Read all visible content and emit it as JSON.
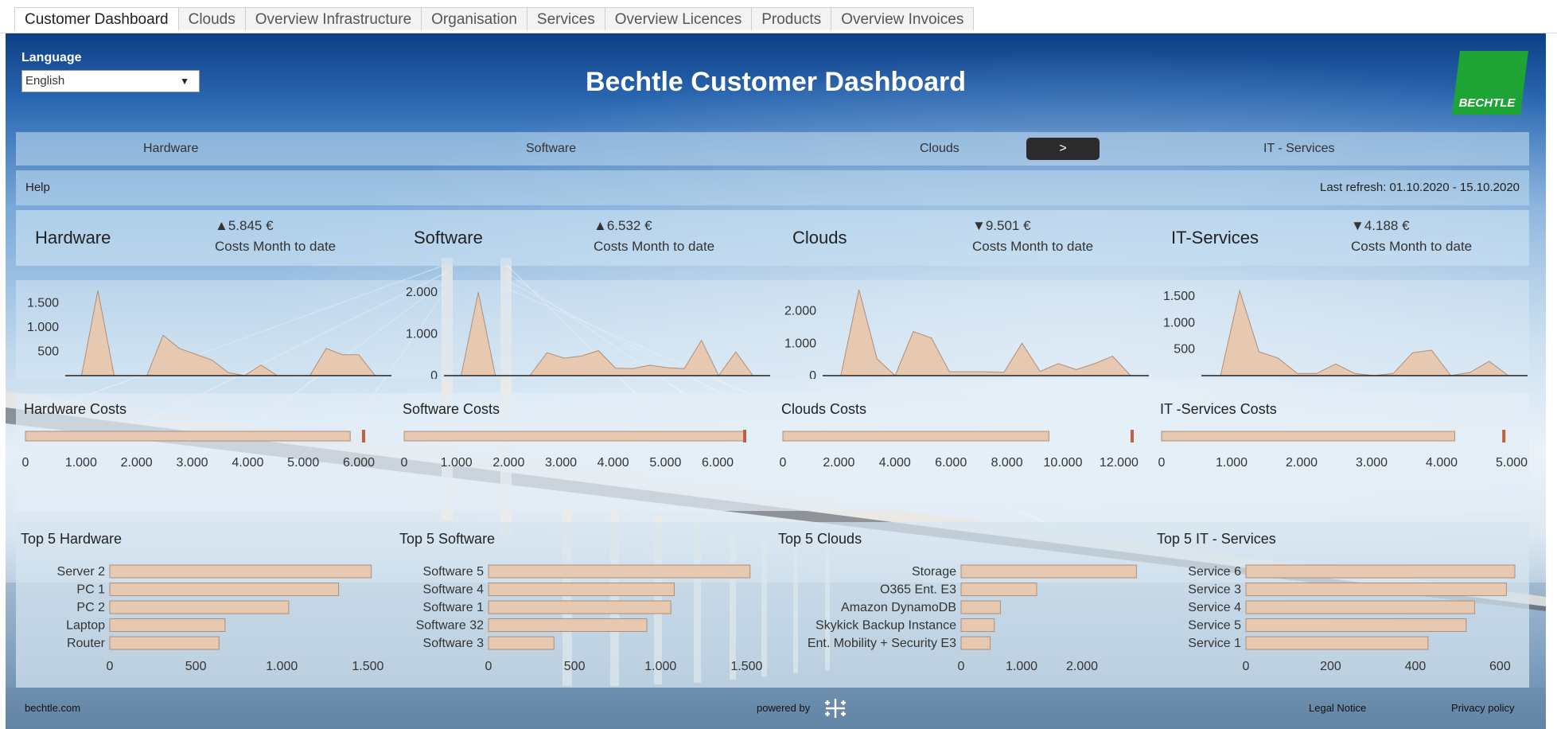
{
  "tabs": [
    "Customer Dashboard",
    "Clouds",
    "Overview Infrastructure",
    "Organisation",
    "Services",
    "Overview Licences",
    "Products",
    "Overview Invoices"
  ],
  "header": {
    "title": "Bechtle Customer Dashboard",
    "language_label": "Language",
    "language_value": "English",
    "logo_text": "BECHTLE"
  },
  "nav": {
    "hardware": "Hardware",
    "software": "Software",
    "clouds": "Clouds",
    "arrow": ">",
    "it_services": "IT - Services"
  },
  "help": "Help",
  "last_refresh": "Last refresh: 01.10.2020 - 15.10.2020",
  "kpis": [
    {
      "name": "Hardware",
      "value": "▲5.845 €",
      "label": "Costs Month to date"
    },
    {
      "name": "Software",
      "value": "▲6.532 €",
      "label": "Costs Month to date"
    },
    {
      "name": "Clouds",
      "value": "▼9.501 €",
      "label": "Costs Month to date"
    },
    {
      "name": "IT-Services",
      "value": "▼4.188 €",
      "label": "Costs Month to date"
    }
  ],
  "colors": {
    "bar": "#e7c8b0",
    "bar_edge": "#b08e77",
    "marker": "#c0603e",
    "logo": "#1ea335",
    "arrow_bg": "#2b2b2b"
  },
  "footer": {
    "left": "bechtle.com",
    "powered": "powered by",
    "legal": "Legal Notice",
    "privacy": "Privacy policy"
  },
  "chart_data": [
    {
      "type": "area",
      "group": "hardware",
      "y_ticks": [
        "500",
        "1.000",
        "1.500"
      ],
      "ylim": [
        0,
        1800
      ],
      "values": [
        0,
        0,
        1750,
        0,
        0,
        0,
        830,
        560,
        440,
        320,
        60,
        0,
        220,
        0,
        0,
        0,
        560,
        430,
        430,
        0,
        0
      ]
    },
    {
      "type": "area",
      "group": "software",
      "y_ticks": [
        "0",
        "1.000",
        "2.000"
      ],
      "ylim": [
        0,
        2100
      ],
      "values": [
        0,
        0,
        2000,
        0,
        0,
        0,
        550,
        420,
        470,
        600,
        180,
        170,
        250,
        190,
        170,
        850,
        0,
        570,
        0,
        0
      ]
    },
    {
      "type": "area",
      "group": "clouds",
      "y_ticks": [
        "0",
        "1.000",
        "2.000"
      ],
      "ylim": [
        0,
        2700
      ],
      "values": [
        0,
        0,
        2650,
        520,
        0,
        1360,
        1160,
        120,
        120,
        120,
        100,
        1000,
        130,
        370,
        190,
        370,
        600,
        0,
        0
      ]
    },
    {
      "type": "area",
      "group": "it_services",
      "y_ticks": [
        "500",
        "1.000",
        "1.500"
      ],
      "ylim": [
        0,
        1650
      ],
      "values": [
        0,
        0,
        1600,
        450,
        330,
        40,
        40,
        220,
        40,
        0,
        40,
        430,
        480,
        0,
        60,
        270,
        0,
        0
      ]
    },
    {
      "type": "bar",
      "title": "Hardware Costs",
      "ticks": [
        "0",
        "1.000",
        "2.000",
        "3.000",
        "4.000",
        "5.000",
        "6.000"
      ],
      "xlim": [
        0,
        6300
      ],
      "value": 5845,
      "reference": 6100
    },
    {
      "type": "bar",
      "title": "Software Costs",
      "ticks": [
        "0",
        "1.000",
        "2.000",
        "3.000",
        "4.000",
        "5.000",
        "6.000"
      ],
      "xlim": [
        0,
        6700
      ],
      "value": 6532,
      "reference": 6532
    },
    {
      "type": "bar",
      "title": "Clouds Costs",
      "ticks": [
        "0",
        "2.000",
        "4.000",
        "6.000",
        "8.000",
        "10.000",
        "12.000"
      ],
      "xlim": [
        0,
        12500
      ],
      "value": 9501,
      "reference": 13000
    },
    {
      "type": "bar",
      "title": "IT -Services Costs",
      "ticks": [
        "0",
        "1.000",
        "2.000",
        "3.000",
        "4.000",
        "5.000"
      ],
      "xlim": [
        0,
        5000
      ],
      "value": 4188,
      "reference": 4900
    },
    {
      "type": "bar",
      "title": "Top 5 Hardware",
      "categories": [
        "Server 2",
        "PC 1",
        "PC 2",
        "Laptop",
        "Router"
      ],
      "values": [
        1520,
        1330,
        1040,
        670,
        635
      ],
      "ticks": [
        "0",
        "500",
        "1.000",
        "1.500"
      ],
      "tick_values": [
        0,
        500,
        1000,
        1500
      ],
      "xlim": [
        0,
        1600
      ]
    },
    {
      "type": "bar",
      "title": "Top 5 Software",
      "categories": [
        "Software 5",
        "Software 4",
        "Software 1",
        "Software 32",
        "Software 3"
      ],
      "values": [
        1520,
        1080,
        1060,
        920,
        380
      ],
      "ticks": [
        "0",
        "500",
        "1.000",
        "1.500"
      ],
      "tick_values": [
        0,
        500,
        1000,
        1500
      ],
      "xlim": [
        0,
        1600
      ]
    },
    {
      "type": "bar",
      "title": "Top 5 Clouds",
      "categories": [
        "Storage",
        "O365 Ent. E3",
        "Amazon DynamoDB",
        "Skykick Backup Instance",
        "Ent. Mobility + Security E3"
      ],
      "values": [
        2900,
        1250,
        650,
        550,
        480
      ],
      "ticks": [
        "0",
        "1.000",
        "2.000"
      ],
      "tick_values": [
        0,
        1000,
        2000
      ],
      "xlim": [
        0,
        3000
      ]
    },
    {
      "type": "bar",
      "title": "Top 5 IT - Services",
      "categories": [
        "Service 6",
        "Service 3",
        "Service 4",
        "Service 5",
        "Service 1"
      ],
      "values": [
        635,
        615,
        540,
        520,
        430
      ],
      "ticks": [
        "0",
        "200",
        "400",
        "600"
      ],
      "tick_values": [
        0,
        200,
        400,
        600
      ],
      "xlim": [
        0,
        650
      ]
    }
  ]
}
